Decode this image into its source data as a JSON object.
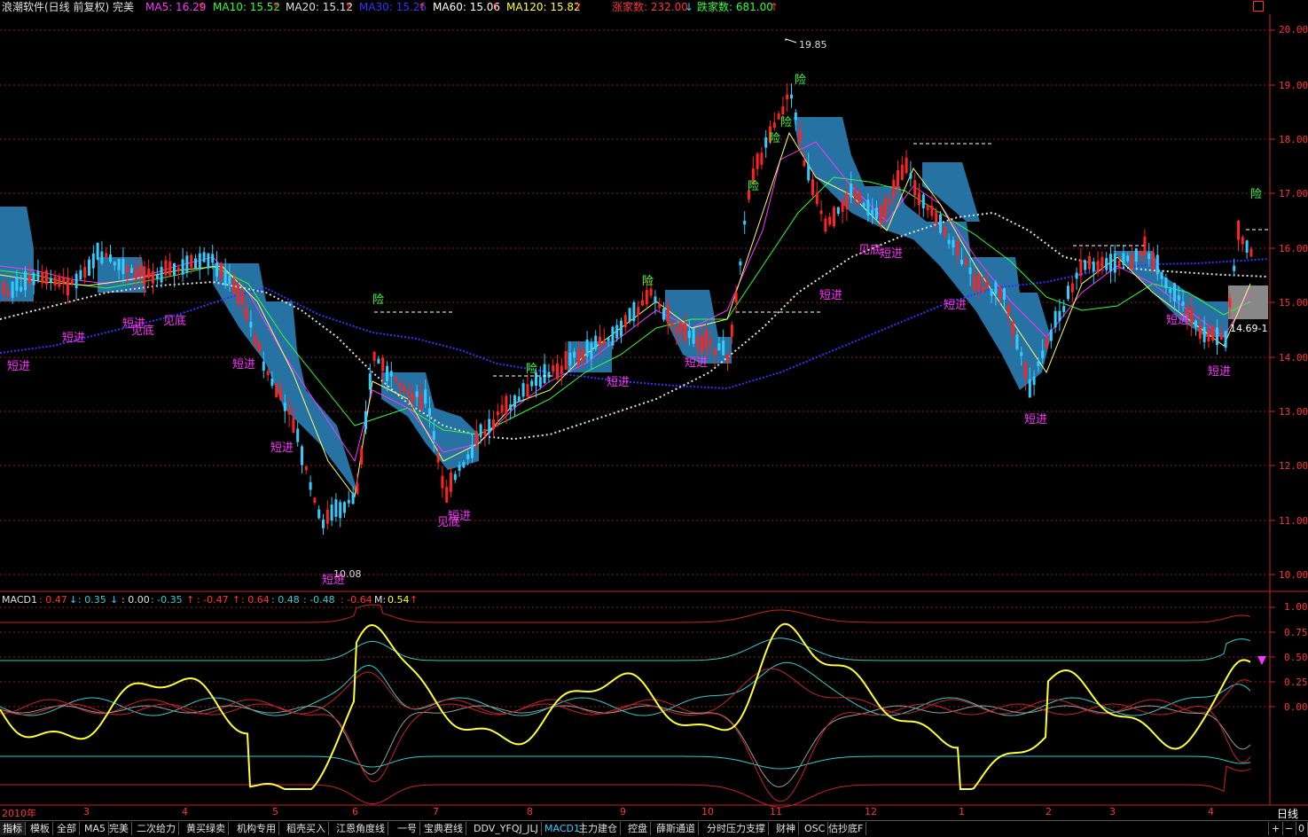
{
  "legend": {
    "title": "浪潮软件(日线 前复权) 完美",
    "ma5": "MA5: 16.29",
    "ma10": "MA10: 15.52",
    "ma20": "MA20: 15.12",
    "ma30": "MA30: 15.26",
    "ma60": "MA60: 15.06",
    "ma120": "MA120: 15.82",
    "up_count": "涨家数: 232.00",
    "down_count": "跌家数: 681.00",
    "arrow_up": "↑",
    "arrow_down": "↓",
    "colors": {
      "ma5": "#ff33ff",
      "ma10": "#33ff33",
      "ma20": "#e0e0e0",
      "ma30": "#3333ff",
      "ma60": "#ffffff",
      "ma120": "#ffff33",
      "up": "#ff3333",
      "down": "#33ff33"
    }
  },
  "price_axis": [
    "20.00",
    "19.00",
    "18.00",
    "17.00",
    "16.00",
    "15.00",
    "14.00",
    "13.00",
    "12.00",
    "11.00",
    "10.00"
  ],
  "annotations": {
    "high": "19.85",
    "low": "10.08",
    "last": "14.69-1",
    "signals": {
      "short_entry": "短进",
      "bottom": "见底",
      "risk": "险"
    }
  },
  "macd": {
    "name": "MACD1",
    "v1": ": 0.47",
    "v2": ": 0.35",
    "v3": ": 0.00",
    "v4": ": -0.35",
    "v5": ": -0.47",
    "v6": ": 0.64",
    "v7": ": 0.48",
    "v8": ": -0.48",
    "v9": ": -0.64",
    "m_label": "M: ",
    "m_value": "0.54",
    "axis": [
      "1.00",
      "0.75",
      "0.50",
      "0.25",
      "0.00"
    ]
  },
  "date_axis": [
    "2010年",
    "3",
    "4",
    "5",
    "6",
    "7",
    "8",
    "9",
    "10",
    "11",
    "12",
    "1",
    "2",
    "3",
    "4"
  ],
  "period_label": "日线",
  "tabs": [
    "指标",
    "模板",
    "全部",
    "MA5",
    "完美",
    "二次给力",
    "黄买绿卖",
    "机构专用",
    "稻壳买入",
    "江恩角度线",
    "一号",
    "宝典君线",
    "DDV_YFQJ_JLJ",
    "MACD1",
    "主力建仓",
    "控盘",
    "薛斯通道",
    "分时压力支撑",
    "财神",
    "OSC",
    "估抄底F"
  ],
  "controls": {
    "plus": "+",
    "minus": "−",
    "zero": "0"
  }
}
